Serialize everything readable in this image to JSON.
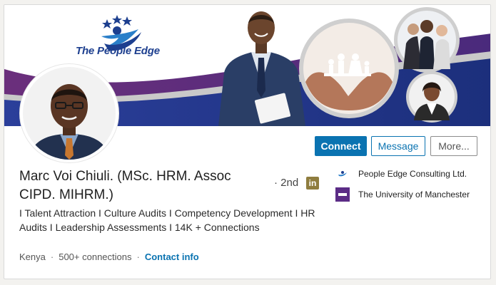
{
  "banner": {
    "brand_name": "The People Edge",
    "icons": [
      "star-icon",
      "person-logo-icon",
      "family-paper-cutout-icon"
    ]
  },
  "actions": {
    "connect": "Connect",
    "message": "Message",
    "more": "More..."
  },
  "profile": {
    "name": "Marc Voi Chiuli. (MSc. HRM. Assoc CIPD. MIHRM.)",
    "degree": "· 2nd",
    "badge": "in",
    "headline": "I Talent Attraction I Culture Audits I Competency Development I HR Audits I Leadership Assessments I 14K + Connections",
    "location": "Kenya",
    "connections": "500+ connections",
    "contact": "Contact info"
  },
  "experience": [
    {
      "name": "People Edge Consulting Ltd.",
      "logo": "people-edge-logo-icon"
    },
    {
      "name": "The University of Manchester",
      "logo": "university-logo-icon"
    }
  ],
  "colors": {
    "brand_blue": "#0a73b1",
    "banner_navy": "#1d3f8f",
    "banner_purple": "#5b2c86",
    "badge_gold": "#8f7d3f"
  }
}
